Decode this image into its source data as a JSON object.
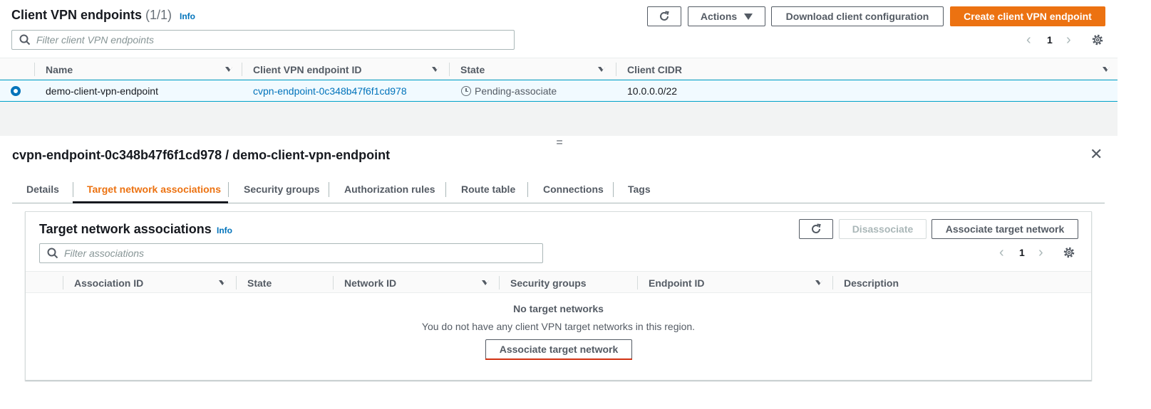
{
  "endpoints": {
    "title": "Client VPN endpoints",
    "count": "(1/1)",
    "info": "Info",
    "actions_label": "Actions",
    "download_label": "Download client configuration",
    "create_label": "Create client VPN endpoint",
    "filter_placeholder": "Filter client VPN endpoints",
    "page": "1",
    "columns": [
      "Name",
      "Client VPN endpoint ID",
      "State",
      "Client CIDR"
    ],
    "rows": [
      {
        "name": "demo-client-vpn-endpoint",
        "id": "cvpn-endpoint-0c348b47f6f1cd978",
        "state": "Pending-associate",
        "cidr": "10.0.0.0/22"
      }
    ]
  },
  "split": {
    "handle": "="
  },
  "detail": {
    "title": "cvpn-endpoint-0c348b47f6f1cd978 / demo-client-vpn-endpoint",
    "tabs": [
      "Details",
      "Target network associations",
      "Security groups",
      "Authorization rules",
      "Route table",
      "Connections",
      "Tags"
    ],
    "active_tab": "Target network associations"
  },
  "associations": {
    "title": "Target network associations",
    "info": "Info",
    "disassociate_label": "Disassociate",
    "associate_label": "Associate target network",
    "filter_placeholder": "Filter associations",
    "page": "1",
    "columns": [
      "Association ID",
      "State",
      "Network ID",
      "Security groups",
      "Endpoint ID",
      "Description"
    ],
    "empty_title": "No target networks",
    "empty_message": "You do not have any client VPN target networks in this region.",
    "empty_button": "Associate target network"
  },
  "colors": {
    "accent": "#ec7211",
    "link": "#0073bb",
    "selected_row": "#f1faff",
    "border": "#d5dbdb"
  }
}
